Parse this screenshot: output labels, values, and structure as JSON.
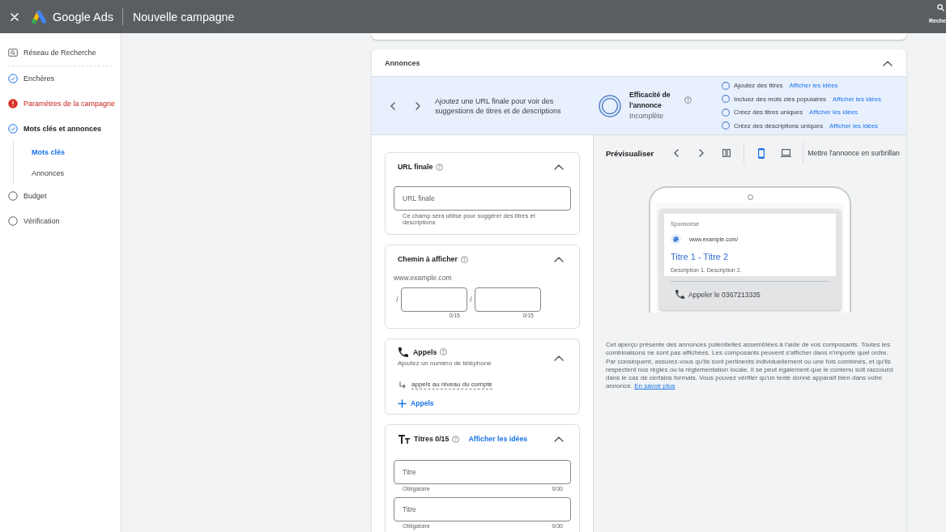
{
  "top_bar": {
    "product": "Google Ads",
    "title": "Nouvelle campagne",
    "search_label": "Reche"
  },
  "sidebar": {
    "items": [
      {
        "kind": "type",
        "label": "Réseau de Recherche",
        "selected": false
      },
      {
        "kind": "done",
        "label": "Enchères",
        "selected": false
      },
      {
        "kind": "error",
        "label": "Paramètres de la campagne",
        "selected": false
      },
      {
        "kind": "done",
        "label": "Mots clés et annonces",
        "selected": true,
        "children": [
          {
            "label": "Mots clés",
            "selected": true
          },
          {
            "label": "Annonces",
            "selected": false
          }
        ]
      },
      {
        "kind": "todo",
        "label": "Budget",
        "selected": false
      },
      {
        "kind": "todo",
        "label": "Vérification",
        "selected": false
      }
    ]
  },
  "ads_section": {
    "title": "Annonces",
    "expanded": true,
    "banner": {
      "message": "Ajoutez une URL finale pour voir des suggestions de titres et de descriptions",
      "strength": {
        "title": "Efficacité de l'annonce",
        "status": "Incomplète"
      },
      "checklist": [
        {
          "label": "Ajoutez des titres",
          "link": "Afficher les idées",
          "checked": false
        },
        {
          "label": "Incluez des mots clés populaires",
          "link": "Afficher les idées",
          "checked": false
        },
        {
          "label": "Créez des titres uniques",
          "link": "Afficher les idées",
          "checked": false
        },
        {
          "label": "Créez des descriptions uniques",
          "link": "Afficher les idées",
          "checked": false
        }
      ]
    },
    "form": [
      {
        "kind": "url",
        "title": "URL finale",
        "expanded": true,
        "placeholder": "URL finale",
        "hint": "Ce champ sera utilisé pour suggérer des titres et descriptions"
      },
      {
        "kind": "path",
        "title": "Chemin à afficher",
        "expanded": true,
        "domain": "www.example.com",
        "paths": [
          {
            "separator": "/",
            "counter": "0/15"
          },
          {
            "separator": "/",
            "counter": "0/15"
          }
        ]
      },
      {
        "kind": "calls",
        "title": "Appels",
        "expanded": true,
        "subtitle": "Ajoutez un numéro de téléphone",
        "account_link": "appels au niveau du compte",
        "add_label": "Appels"
      },
      {
        "kind": "headlines",
        "title": "Titres 0/15",
        "link": "Afficher les idées",
        "expanded": true,
        "fields": [
          {
            "placeholder": "Titre",
            "helper": "Obligatoire",
            "counter": "0/30"
          },
          {
            "placeholder": "Titre",
            "helper": "Obligatoire",
            "counter": "0/30"
          }
        ]
      }
    ],
    "preview": {
      "title": "Prévisualiser",
      "devices": [
        {
          "kind": "mobile",
          "selected": true
        },
        {
          "kind": "desktop",
          "selected": false
        }
      ],
      "highlight_label": "Mettre l'annonce en surbrillan",
      "ad": {
        "label": "Sponsorisé",
        "url": "www.example.com/",
        "headline": "Titre 1 - Titre 2",
        "description": "Description 1. Description 2.",
        "call": "Appeler le 0367213335"
      },
      "disclaimer": "Cet aperçu présente des annonces potentielles assemblées à l'aide de vos composants. Toutes les combinaisons ne sont pas affichées. Les composants peuvent s'afficher dans n'importe quel ordre. Par conséquent, assurez-vous qu'ils sont pertinents individuellement ou une fois combinés, et qu'ils respectent nos règles ou la réglementation locale. Il se peut également que le contenu soit raccourci dans le cas de certains formats. Vous pouvez vérifier qu'un texte donné apparaît bien dans votre annonce.",
      "learn_more": "En savoir plus"
    }
  }
}
